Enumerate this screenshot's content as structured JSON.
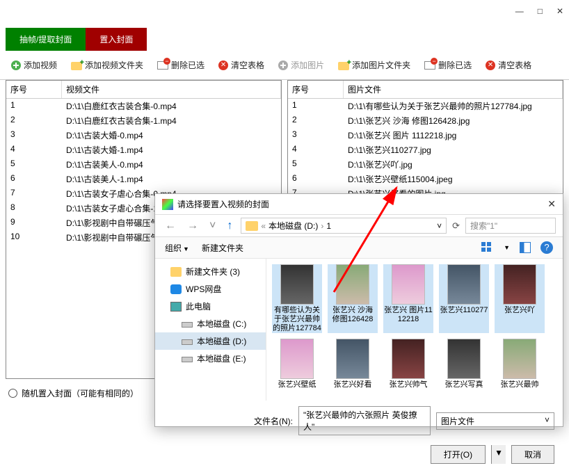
{
  "window": {
    "min": "—",
    "max": "□",
    "close": "✕"
  },
  "tabs": {
    "extract": "抽帧/提取封面",
    "insert": "置入封面"
  },
  "toolbar": {
    "add_video": "添加视频",
    "add_video_folder": "添加视频文件夹",
    "del_sel1": "删除已选",
    "clear1": "清空表格",
    "add_img": "添加图片",
    "add_img_folder": "添加图片文件夹",
    "del_sel2": "删除已选",
    "clear2": "清空表格"
  },
  "table_video": {
    "h1": "序号",
    "h2": "视频文件",
    "rows": [
      {
        "n": "1",
        "f": "D:\\1\\白鹿红衣古装合集-0.mp4"
      },
      {
        "n": "2",
        "f": "D:\\1\\白鹿红衣古装合集-1.mp4"
      },
      {
        "n": "3",
        "f": "D:\\1\\古装大婚-0.mp4"
      },
      {
        "n": "4",
        "f": "D:\\1\\古装大婚-1.mp4"
      },
      {
        "n": "5",
        "f": "D:\\1\\古装美人-0.mp4"
      },
      {
        "n": "6",
        "f": "D:\\1\\古装美人-1.mp4"
      },
      {
        "n": "7",
        "f": "D:\\1\\古装女子虐心合集-0.mp4"
      },
      {
        "n": "8",
        "f": "D:\\1\\古装女子虐心合集-1"
      },
      {
        "n": "9",
        "f": "D:\\1\\影视剧中自带碾压气"
      },
      {
        "n": "10",
        "f": "D:\\1\\影视剧中自带碾压气"
      }
    ]
  },
  "table_img": {
    "h1": "序号",
    "h2": "图片文件",
    "rows": [
      {
        "n": "1",
        "f": "D:\\1\\有哪些认为关于张艺兴最帅的照片127784.jpg"
      },
      {
        "n": "2",
        "f": "D:\\1\\张艺兴 沙海 修图126428.jpg"
      },
      {
        "n": "3",
        "f": "D:\\1\\张艺兴 图片 1112218.jpg"
      },
      {
        "n": "4",
        "f": "D:\\1\\张艺兴110277.jpg"
      },
      {
        "n": "5",
        "f": "D:\\1\\张艺兴吖.jpg"
      },
      {
        "n": "6",
        "f": "D:\\1\\张艺兴壁纸115004.jpeg"
      },
      {
        "n": "7",
        "f": "D:\\1\\张艺兴好看的图片.jpg"
      }
    ]
  },
  "bottom": {
    "random": "随机置入封面（可能有相同的）"
  },
  "dialog": {
    "title": "请选择要置入视频的封面",
    "path_drive": "本地磁盘 (D:)",
    "path_folder": "1",
    "path_sep": "«",
    "path_sep2": "›",
    "search_ph": "搜索\"1\"",
    "organize": "组织",
    "newfolder": "新建文件夹",
    "side": [
      {
        "label": "新建文件夹 (3)",
        "cls": "folder",
        "sub": false
      },
      {
        "label": "WPS网盘",
        "cls": "wps",
        "sub": false
      },
      {
        "label": "此电脑",
        "cls": "pc",
        "sub": false
      },
      {
        "label": "本地磁盘 (C:)",
        "cls": "drive",
        "sub": true
      },
      {
        "label": "本地磁盘 (D:)",
        "cls": "drive",
        "sub": true,
        "sel": true
      },
      {
        "label": "本地磁盘 (E:)",
        "cls": "drive",
        "sub": true
      }
    ],
    "files_r1": [
      {
        "name": "有哪些认为关于张艺兴最帅的照片127784",
        "sel": true
      },
      {
        "name": "张艺兴 沙海 修图126428",
        "sel": true
      },
      {
        "name": "张艺兴 图片1112218",
        "sel": true
      },
      {
        "name": "张艺兴110277",
        "sel": true
      },
      {
        "name": "张艺兴吖",
        "sel": true
      }
    ],
    "files_r2": [
      {
        "name": "张艺兴壁纸"
      },
      {
        "name": "张艺兴好看"
      },
      {
        "name": "张艺兴帅气"
      },
      {
        "name": "张艺兴写真"
      },
      {
        "name": "张艺兴最帅"
      }
    ],
    "fname_label": "文件名(N):",
    "fname_value": "\"张艺兴最帅的六张照片 英俊撩人\"",
    "filter": "图片文件",
    "open": "打开(O)",
    "cancel": "取消"
  }
}
